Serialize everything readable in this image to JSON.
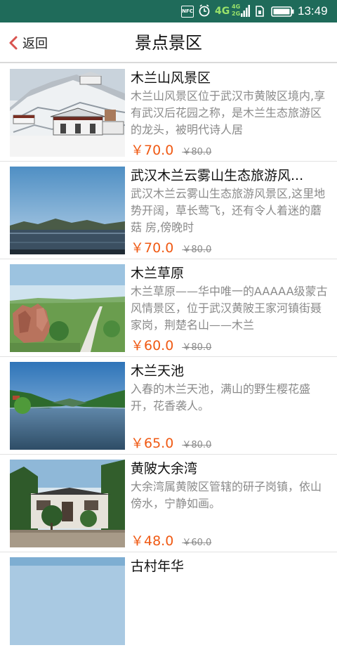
{
  "status_bar": {
    "nfc": "NFC",
    "net_4g": "4G",
    "net_small_1": "4G",
    "net_small_2": "2G",
    "time": "13:49"
  },
  "header": {
    "back_label": "返回",
    "title": "景点景区"
  },
  "items": [
    {
      "name": "木兰山风景区",
      "desc": "木兰山风景区位于武汉市黄陂区境内,享有武汉后花园之称，是木兰生态旅游区的龙头，被明代诗人居",
      "price": "￥70.0",
      "original_price": "￥80.0"
    },
    {
      "name": "武汉木兰云雾山生态旅游风...",
      "desc": "武汉木兰云雾山生态旅游风景区,这里地势开阔，草长莺飞，还有令人着迷的蘑菇 房,傍晚时",
      "price": "￥70.0",
      "original_price": "￥80.0"
    },
    {
      "name": "木兰草原",
      "desc": "木兰草原——华中唯一的AAAAA级蒙古风情景区，位于武汉黄陂王家河镇街聂家岗，荆楚名山——木兰",
      "price": "￥60.0",
      "original_price": "￥80.0"
    },
    {
      "name": "木兰天池",
      "desc": "入春的木兰天池，满山的野生樱花盛开，花香袭人。",
      "price": "￥65.0",
      "original_price": "￥80.0"
    },
    {
      "name": "黄陂大余湾",
      "desc": "大余湾属黄陂区管辖的研子岗镇，依山傍水，宁静如画。",
      "price": "￥48.0",
      "original_price": "￥60.0"
    },
    {
      "name": "古村年华",
      "desc": "",
      "price": "",
      "original_price": ""
    }
  ],
  "colors": {
    "status_bar": "#1f6b5a",
    "back_arrow": "#d9534f",
    "price": "#f05a14"
  }
}
